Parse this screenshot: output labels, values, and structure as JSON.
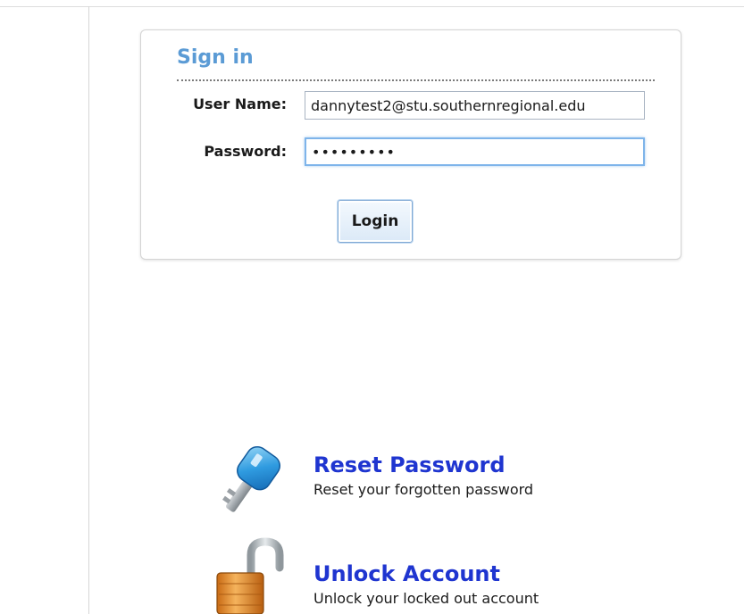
{
  "signin": {
    "title": "Sign in",
    "username_label": "User Name:",
    "username_value": "dannytest2@stu.southernregional.edu",
    "password_label": "Password:",
    "password_masked": "•••••••••",
    "login_label": "Login"
  },
  "links": {
    "reset": {
      "icon": "key-icon",
      "title": "Reset Password",
      "description": "Reset your forgotten password"
    },
    "unlock": {
      "icon": "open-padlock-icon",
      "title": "Unlock Account",
      "description": "Unlock your locked out account"
    }
  },
  "colors": {
    "title_blue": "#5b9bd5",
    "link_blue": "#1f35d0",
    "focus_blue": "#7eb4ea"
  }
}
